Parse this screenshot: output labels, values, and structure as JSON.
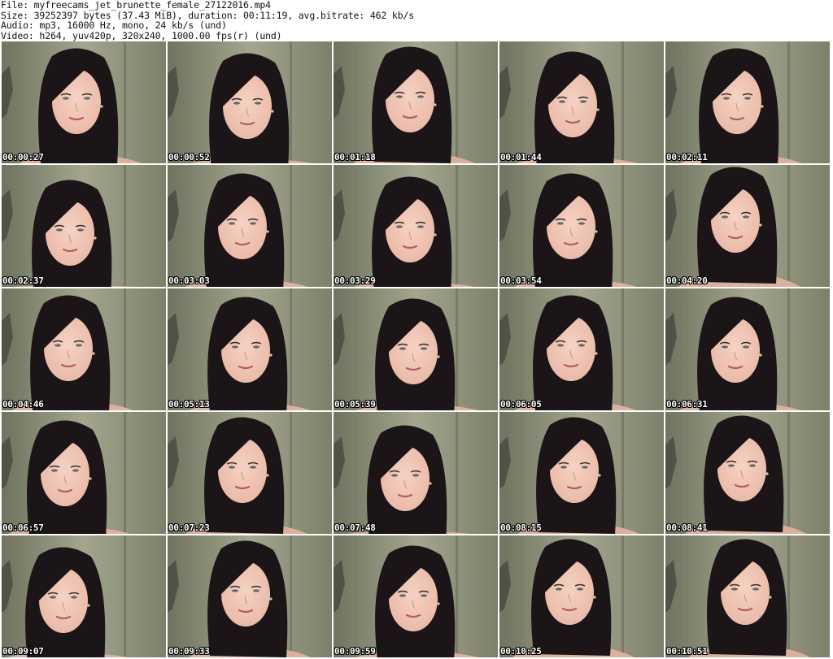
{
  "header": {
    "file_line": "File: myfreecams_jet_brunette_female_27122016.mp4",
    "size_line": "Size: 39252397 bytes (37.43 MiB), duration: 00:11:19, avg.bitrate: 462 kb/s",
    "audio_line": "Audio: mp3, 16000 Hz, mono, 24 kb/s (und)",
    "video_line": "Video: h264, yuv420p, 320x240, 1000.00 fps(r) (und)"
  },
  "thumbnails": [
    {
      "timestamp": "00:00:27"
    },
    {
      "timestamp": "00:00:52"
    },
    {
      "timestamp": "00:01:18"
    },
    {
      "timestamp": "00:01:44"
    },
    {
      "timestamp": "00:02:11"
    },
    {
      "timestamp": "00:02:37"
    },
    {
      "timestamp": "00:03:03"
    },
    {
      "timestamp": "00:03:29"
    },
    {
      "timestamp": "00:03:54"
    },
    {
      "timestamp": "00:04:20"
    },
    {
      "timestamp": "00:04:46"
    },
    {
      "timestamp": "00:05:13"
    },
    {
      "timestamp": "00:05:39"
    },
    {
      "timestamp": "00:06:05"
    },
    {
      "timestamp": "00:06:31"
    },
    {
      "timestamp": "00:06:57"
    },
    {
      "timestamp": "00:07:23"
    },
    {
      "timestamp": "00:07:48"
    },
    {
      "timestamp": "00:08:15"
    },
    {
      "timestamp": "00:08:41"
    },
    {
      "timestamp": "00:09:07"
    },
    {
      "timestamp": "00:09:33"
    },
    {
      "timestamp": "00:09:59"
    },
    {
      "timestamp": "00:10:25"
    },
    {
      "timestamp": "00:10:51"
    }
  ],
  "colors": {
    "background": "#ffffff",
    "header_text": "#111111",
    "wall": "#8e9178",
    "wall_light": "#a3a68d",
    "hair": "#1b1517",
    "skin": "#e9b8a6",
    "timestamp_text": "#ffffff",
    "timestamp_outline": "#000000"
  }
}
